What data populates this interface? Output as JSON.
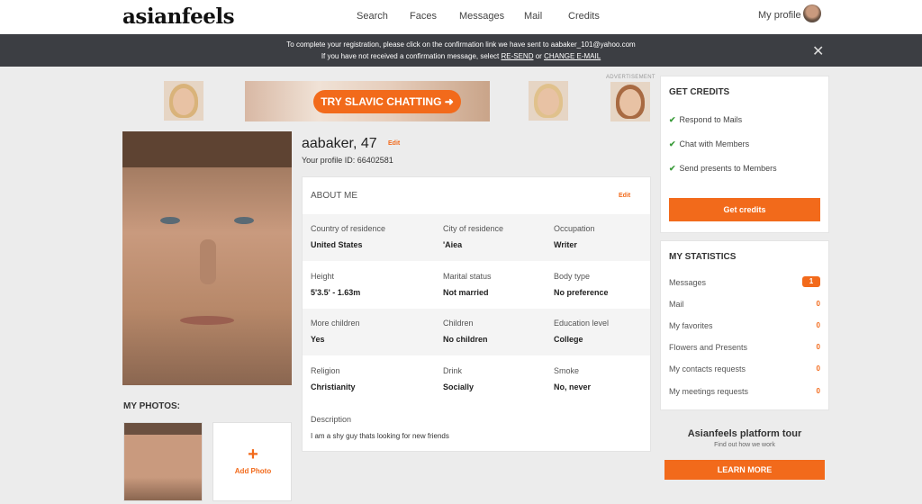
{
  "nav": {
    "logo": "asianfeels",
    "links": [
      "Search",
      "Faces",
      "Messages",
      "Mail",
      "Credits"
    ],
    "my_profile": "My profile"
  },
  "banner": {
    "line1": "To complete your registration, please click on the confirmation link we have sent to aabaker_101@yahoo.com",
    "line2_prefix": "If you have not received a confirmation message, select ",
    "resend": "RE-SEND",
    "or": " or ",
    "change_email": "CHANGE E-MAIL",
    "close": "✕"
  },
  "ad": {
    "button": "TRY SLAVIC CHATTING ➜",
    "label": "ADVERTISEMENT"
  },
  "profile": {
    "name": "aabaker, 47",
    "edit": "Edit",
    "profile_id": "Your profile ID: 66402581"
  },
  "photos": {
    "title": "MY PHOTOS:",
    "add_plus": "+",
    "add_label": "Add Photo"
  },
  "about": {
    "title": "ABOUT ME",
    "edit": "Edit",
    "rows": [
      [
        {
          "k": "Country of residence",
          "v": "United States"
        },
        {
          "k": "City of residence",
          "v": "'Aiea"
        },
        {
          "k": "Occupation",
          "v": "Writer"
        }
      ],
      [
        {
          "k": "Height",
          "v": "5'3.5' - 1.63m"
        },
        {
          "k": "Marital status",
          "v": "Not married"
        },
        {
          "k": "Body type",
          "v": "No preference"
        }
      ],
      [
        {
          "k": "More children",
          "v": "Yes"
        },
        {
          "k": "Children",
          "v": "No children"
        },
        {
          "k": "Education level",
          "v": "College"
        }
      ],
      [
        {
          "k": "Religion",
          "v": "Christianity"
        },
        {
          "k": "Drink",
          "v": "Socially"
        },
        {
          "k": "Smoke",
          "v": "No, never"
        }
      ]
    ],
    "description_label": "Description",
    "description": "I am a shy guy thats looking for new friends"
  },
  "credits": {
    "title": "GET CREDITS",
    "items": [
      "Respond to Mails",
      "Chat with Members",
      "Send presents to Members"
    ],
    "button": "Get credits"
  },
  "stats": {
    "title": "MY STATISTICS",
    "items": [
      {
        "label": "Messages",
        "value": "1"
      },
      {
        "label": "Mail",
        "value": "0"
      },
      {
        "label": "My favorites",
        "value": "0"
      },
      {
        "label": "Flowers and Presents",
        "value": "0"
      },
      {
        "label": "My contacts requests",
        "value": "0"
      },
      {
        "label": "My meetings requests",
        "value": "0"
      }
    ]
  },
  "tour": {
    "title": "Asianfeels platform tour",
    "subtitle": "Find out how we work",
    "button": "LEARN MORE"
  },
  "colors": {
    "accent": "#f26a1b",
    "banner_bg": "#3c3e43",
    "page_bg": "#ececec"
  }
}
